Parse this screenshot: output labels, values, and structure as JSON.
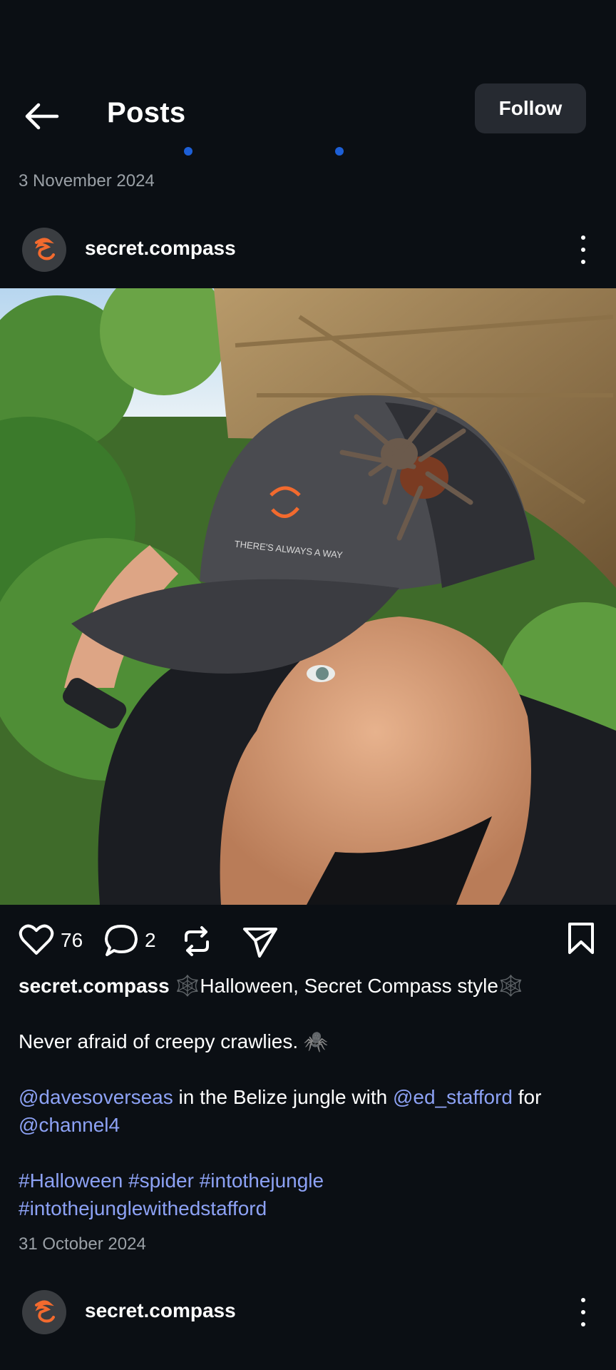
{
  "header": {
    "title": "Posts",
    "follow_label": "Follow",
    "back_icon": "arrow-left-icon"
  },
  "previous_post": {
    "date": "3 November 2024"
  },
  "post": {
    "username": "secret.compass",
    "avatar_icon": "compass-logo-icon",
    "likes": "76",
    "comments": "2",
    "caption": {
      "title_line": "🕸️Halloween, Secret Compass style🕸️",
      "line2": "Never afraid of creepy crawlies. 🕷️",
      "mention1": "@davesoverseas",
      "text_mid": " in the Belize jungle with ",
      "mention2": "@ed_stafford",
      "text_for": " for",
      "mention3": "@channel4",
      "hashtags_line1": "#Halloween #spider #intothejungle",
      "hashtags_line2": "#intothejunglewithedstafford"
    },
    "date": "31 October 2024",
    "image_text": "THERE'S ALWAYS A WAY"
  },
  "next_post": {
    "username": "secret.compass"
  },
  "colors": {
    "background": "#0b0f14",
    "link": "#8da2f5",
    "brand_orange": "#f26a2e"
  }
}
